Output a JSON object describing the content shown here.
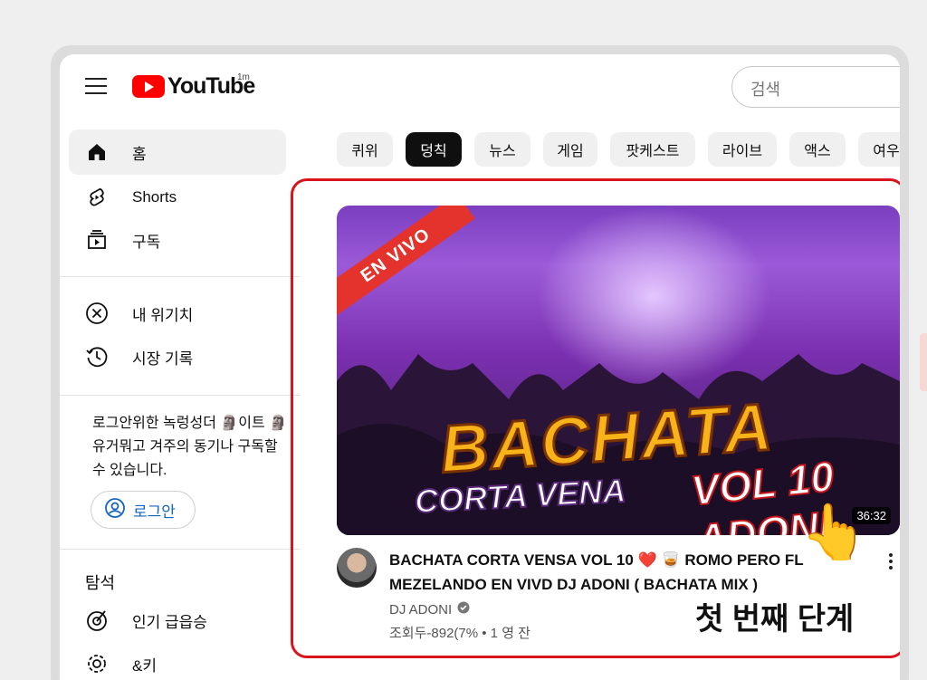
{
  "header": {
    "logo_text": "YouTube",
    "logo_superscript": "1m",
    "search_placeholder": "검색"
  },
  "sidebar": {
    "items": [
      {
        "label": "홈",
        "icon": "home-icon"
      },
      {
        "label": "Shorts",
        "icon": "shorts-icon"
      },
      {
        "label": "구독",
        "icon": "subscriptions-icon"
      },
      {
        "label": "내 위기치",
        "icon": "you-icon"
      },
      {
        "label": "시장 기록",
        "icon": "history-icon"
      }
    ],
    "login_note": "로그안위한 녹렁성더 🗿이트 🗿 유거뭐고 겨주의 동기나 구독할 수 있습니다.",
    "login_button": "로그안",
    "explore_title": "탐석",
    "explore_items": [
      {
        "label": "인기 급읍승",
        "icon": "trending-icon"
      },
      {
        "label": "&키",
        "icon": "settings-icon"
      }
    ]
  },
  "chips": [
    "퀴위",
    "덩칙",
    "뉴스",
    "게임",
    "팟케스트",
    "라이브",
    "액스",
    "여우"
  ],
  "video": {
    "thumbnail_badge": "EN VIVO",
    "thumbnail_title": "BACHATA",
    "thumbnail_subtitle": "CORTA VENA",
    "thumbnail_vol": "VOL 10 ADONI",
    "duration": "36:32",
    "title": "BACHATA CORTA VENSA VOL 10 ❤️ 🥃 ROMO PERO FL MEZELANDO EN VIVD DJ ADONI ( BACHATA MIX )",
    "channel": "DJ ADONI",
    "meta": "조회두-892(7% • 1 영 잔"
  },
  "overlay": {
    "step_label": "첫 번째 단계",
    "pointer_emoji": "👆"
  },
  "colors": {
    "brand_red": "#ff0000",
    "highlight_red": "#d9141c",
    "link_blue": "#1565c0"
  }
}
